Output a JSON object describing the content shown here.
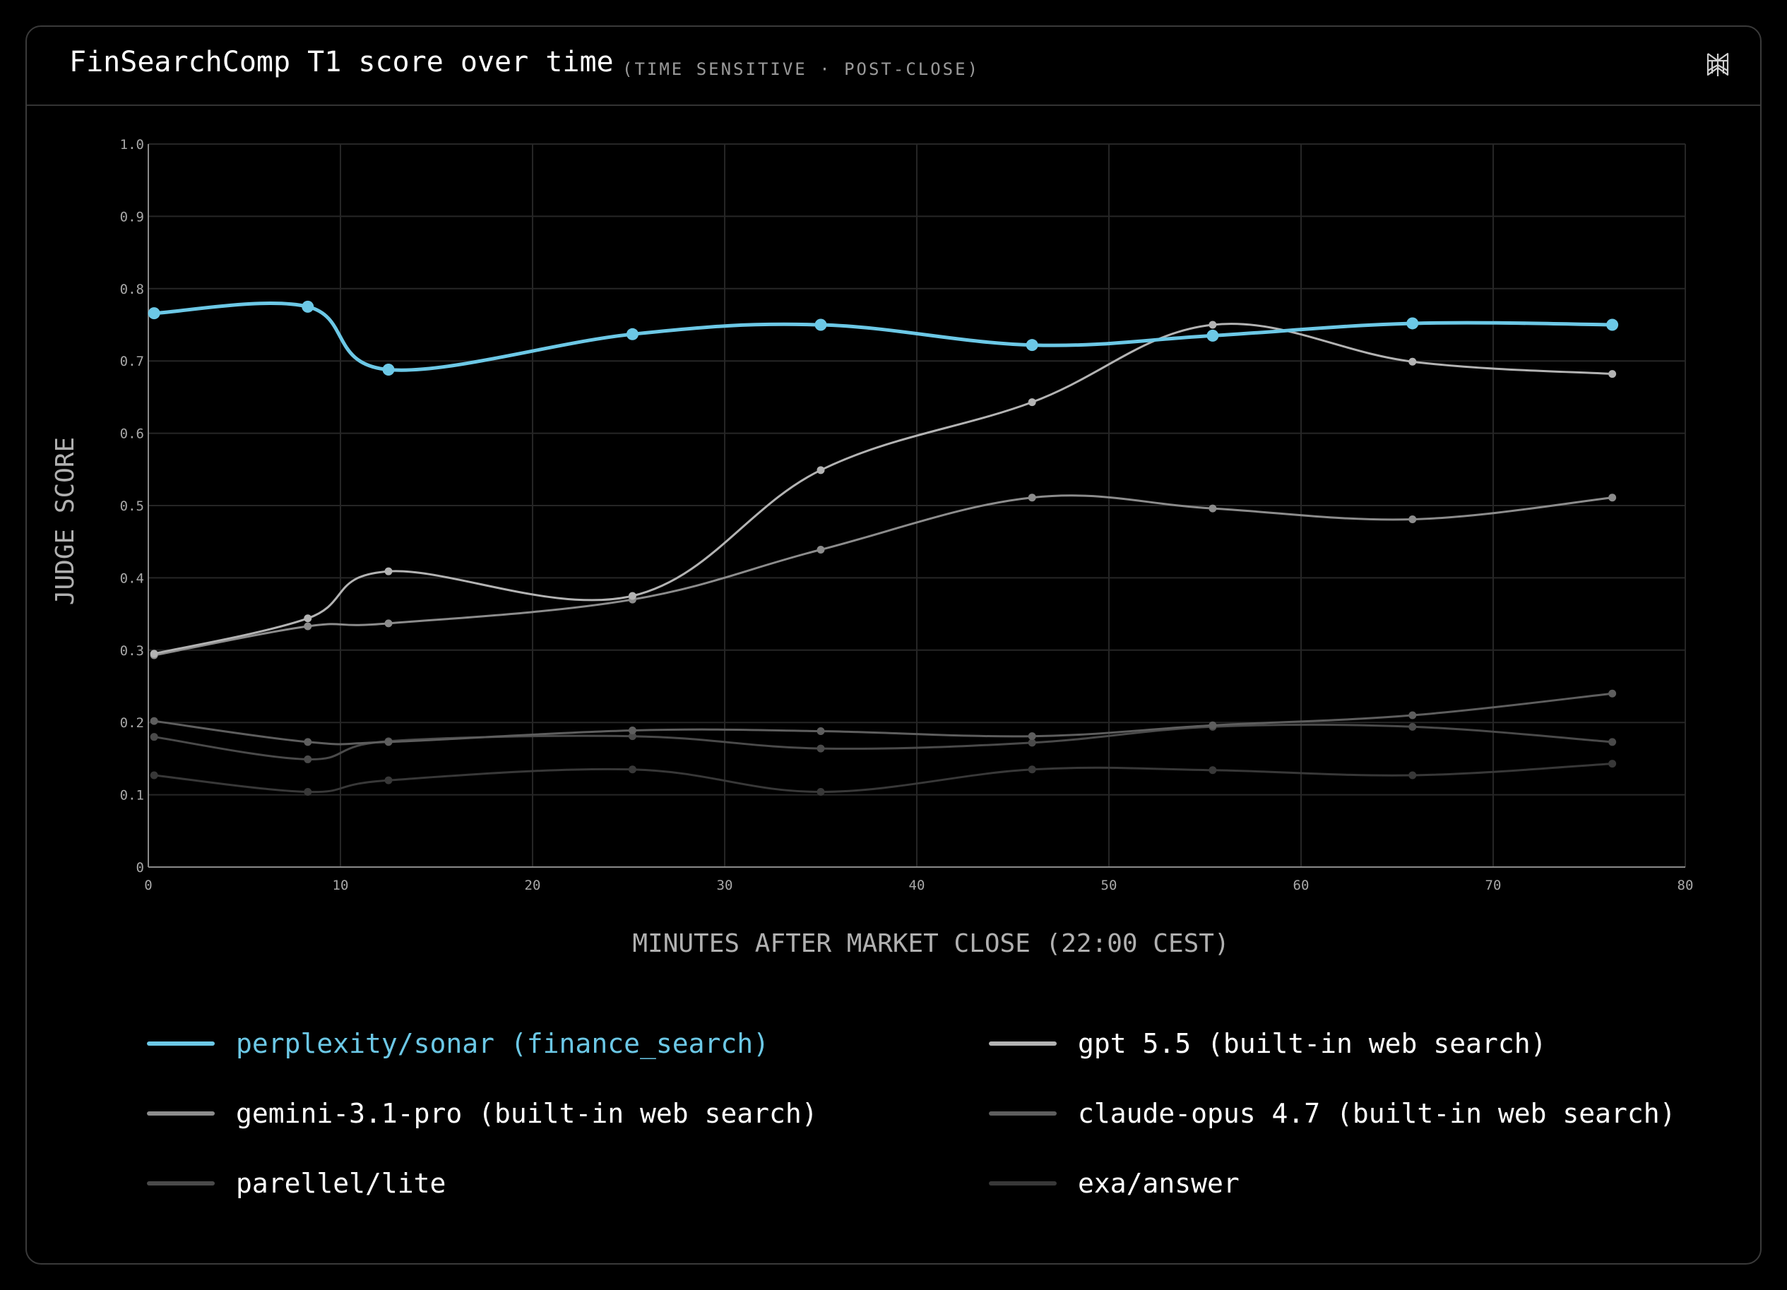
{
  "header": {
    "title": "FinSearchComp T1 score over time",
    "subtitle": "(TIME SENSITIVE · POST-CLOSE)",
    "logo_icon": "perplexity-logo-icon"
  },
  "colors": {
    "background": "#000000",
    "accent": "#6cc8e6",
    "gpt": "#b3b3b3",
    "gemini": "#8c8c8c",
    "claude": "#5e5e5e",
    "parallel": "#4a4a4a",
    "exa": "#383838",
    "grid": "#262626",
    "tick_text": "#a8a8a8"
  },
  "chart_data": {
    "type": "line",
    "title": "FinSearchComp T1 score over time",
    "subtitle": "(TIME SENSITIVE · POST-CLOSE)",
    "xlabel": "MINUTES AFTER MARKET CLOSE (22:00 CEST)",
    "ylabel": "JUDGE SCORE",
    "xlim": [
      0,
      80
    ],
    "ylim": [
      0,
      1.0
    ],
    "xticks": [
      0,
      10,
      20,
      30,
      40,
      50,
      60,
      70,
      80
    ],
    "yticks": [
      0,
      0.1,
      0.2,
      0.3,
      0.4,
      0.5,
      0.6,
      0.7,
      0.8,
      0.9,
      1.0
    ],
    "ytick_labels": [
      "0",
      "0.1",
      "0.2",
      "0.3",
      "0.4",
      "0.5",
      "0.6",
      "0.7",
      "0.8",
      "0.9",
      "1.0"
    ],
    "grid": true,
    "legend_position": "bottom",
    "series": [
      {
        "name": "perplexity/sonar (finance_search)",
        "color": "#6cc8e6",
        "emphasis": true,
        "x": [
          0.3,
          8.3,
          12.5,
          25.2,
          35.0,
          46.0,
          55.4,
          65.8,
          76.2
        ],
        "y": [
          0.766,
          0.775,
          0.688,
          0.737,
          0.75,
          0.722,
          0.735,
          0.752,
          0.75
        ]
      },
      {
        "name": "gpt 5.5 (built-in web search)",
        "color": "#b3b3b3",
        "x": [
          0.3,
          8.3,
          12.5,
          25.2,
          35.0,
          46.0,
          55.4,
          65.8,
          76.2
        ],
        "y": [
          0.295,
          0.344,
          0.409,
          0.375,
          0.549,
          0.643,
          0.75,
          0.699,
          0.682
        ]
      },
      {
        "name": "gemini-3.1-pro (built-in web search)",
        "color": "#8c8c8c",
        "x": [
          0.3,
          8.3,
          12.5,
          25.2,
          35.0,
          46.0,
          55.4,
          65.8,
          76.2
        ],
        "y": [
          0.293,
          0.333,
          0.337,
          0.37,
          0.439,
          0.511,
          0.496,
          0.481,
          0.511
        ]
      },
      {
        "name": "claude-opus 4.7 (built-in web search)",
        "color": "#5e5e5e",
        "x": [
          0.3,
          8.3,
          12.5,
          25.2,
          35.0,
          46.0,
          55.4,
          65.8,
          76.2
        ],
        "y": [
          0.202,
          0.173,
          0.173,
          0.189,
          0.188,
          0.181,
          0.196,
          0.21,
          0.24
        ]
      },
      {
        "name": "parellel/lite",
        "color": "#4a4a4a",
        "x": [
          0.3,
          8.3,
          12.5,
          25.2,
          35.0,
          46.0,
          55.4,
          65.8,
          76.2
        ],
        "y": [
          0.18,
          0.149,
          0.174,
          0.181,
          0.164,
          0.172,
          0.194,
          0.194,
          0.173
        ]
      },
      {
        "name": "exa/answer",
        "color": "#383838",
        "x": [
          0.3,
          8.3,
          12.5,
          25.2,
          35.0,
          46.0,
          55.4,
          65.8,
          76.2
        ],
        "y": [
          0.127,
          0.104,
          0.12,
          0.135,
          0.104,
          0.135,
          0.134,
          0.127,
          0.143
        ]
      }
    ]
  },
  "legend": {
    "items": [
      {
        "label": "perplexity/sonar (finance_search)",
        "color": "#6cc8e6",
        "label_color": "#6cc8e6"
      },
      {
        "label": "gpt 5.5 (built-in web search)",
        "color": "#b3b3b3",
        "label_color": "#ffffff"
      },
      {
        "label": "gemini-3.1-pro (built-in web search)",
        "color": "#8c8c8c",
        "label_color": "#ffffff"
      },
      {
        "label": "claude-opus 4.7 (built-in web search)",
        "color": "#5e5e5e",
        "label_color": "#ffffff"
      },
      {
        "label": "parellel/lite",
        "color": "#4a4a4a",
        "label_color": "#ffffff"
      },
      {
        "label": "exa/answer",
        "color": "#383838",
        "label_color": "#ffffff"
      }
    ]
  }
}
